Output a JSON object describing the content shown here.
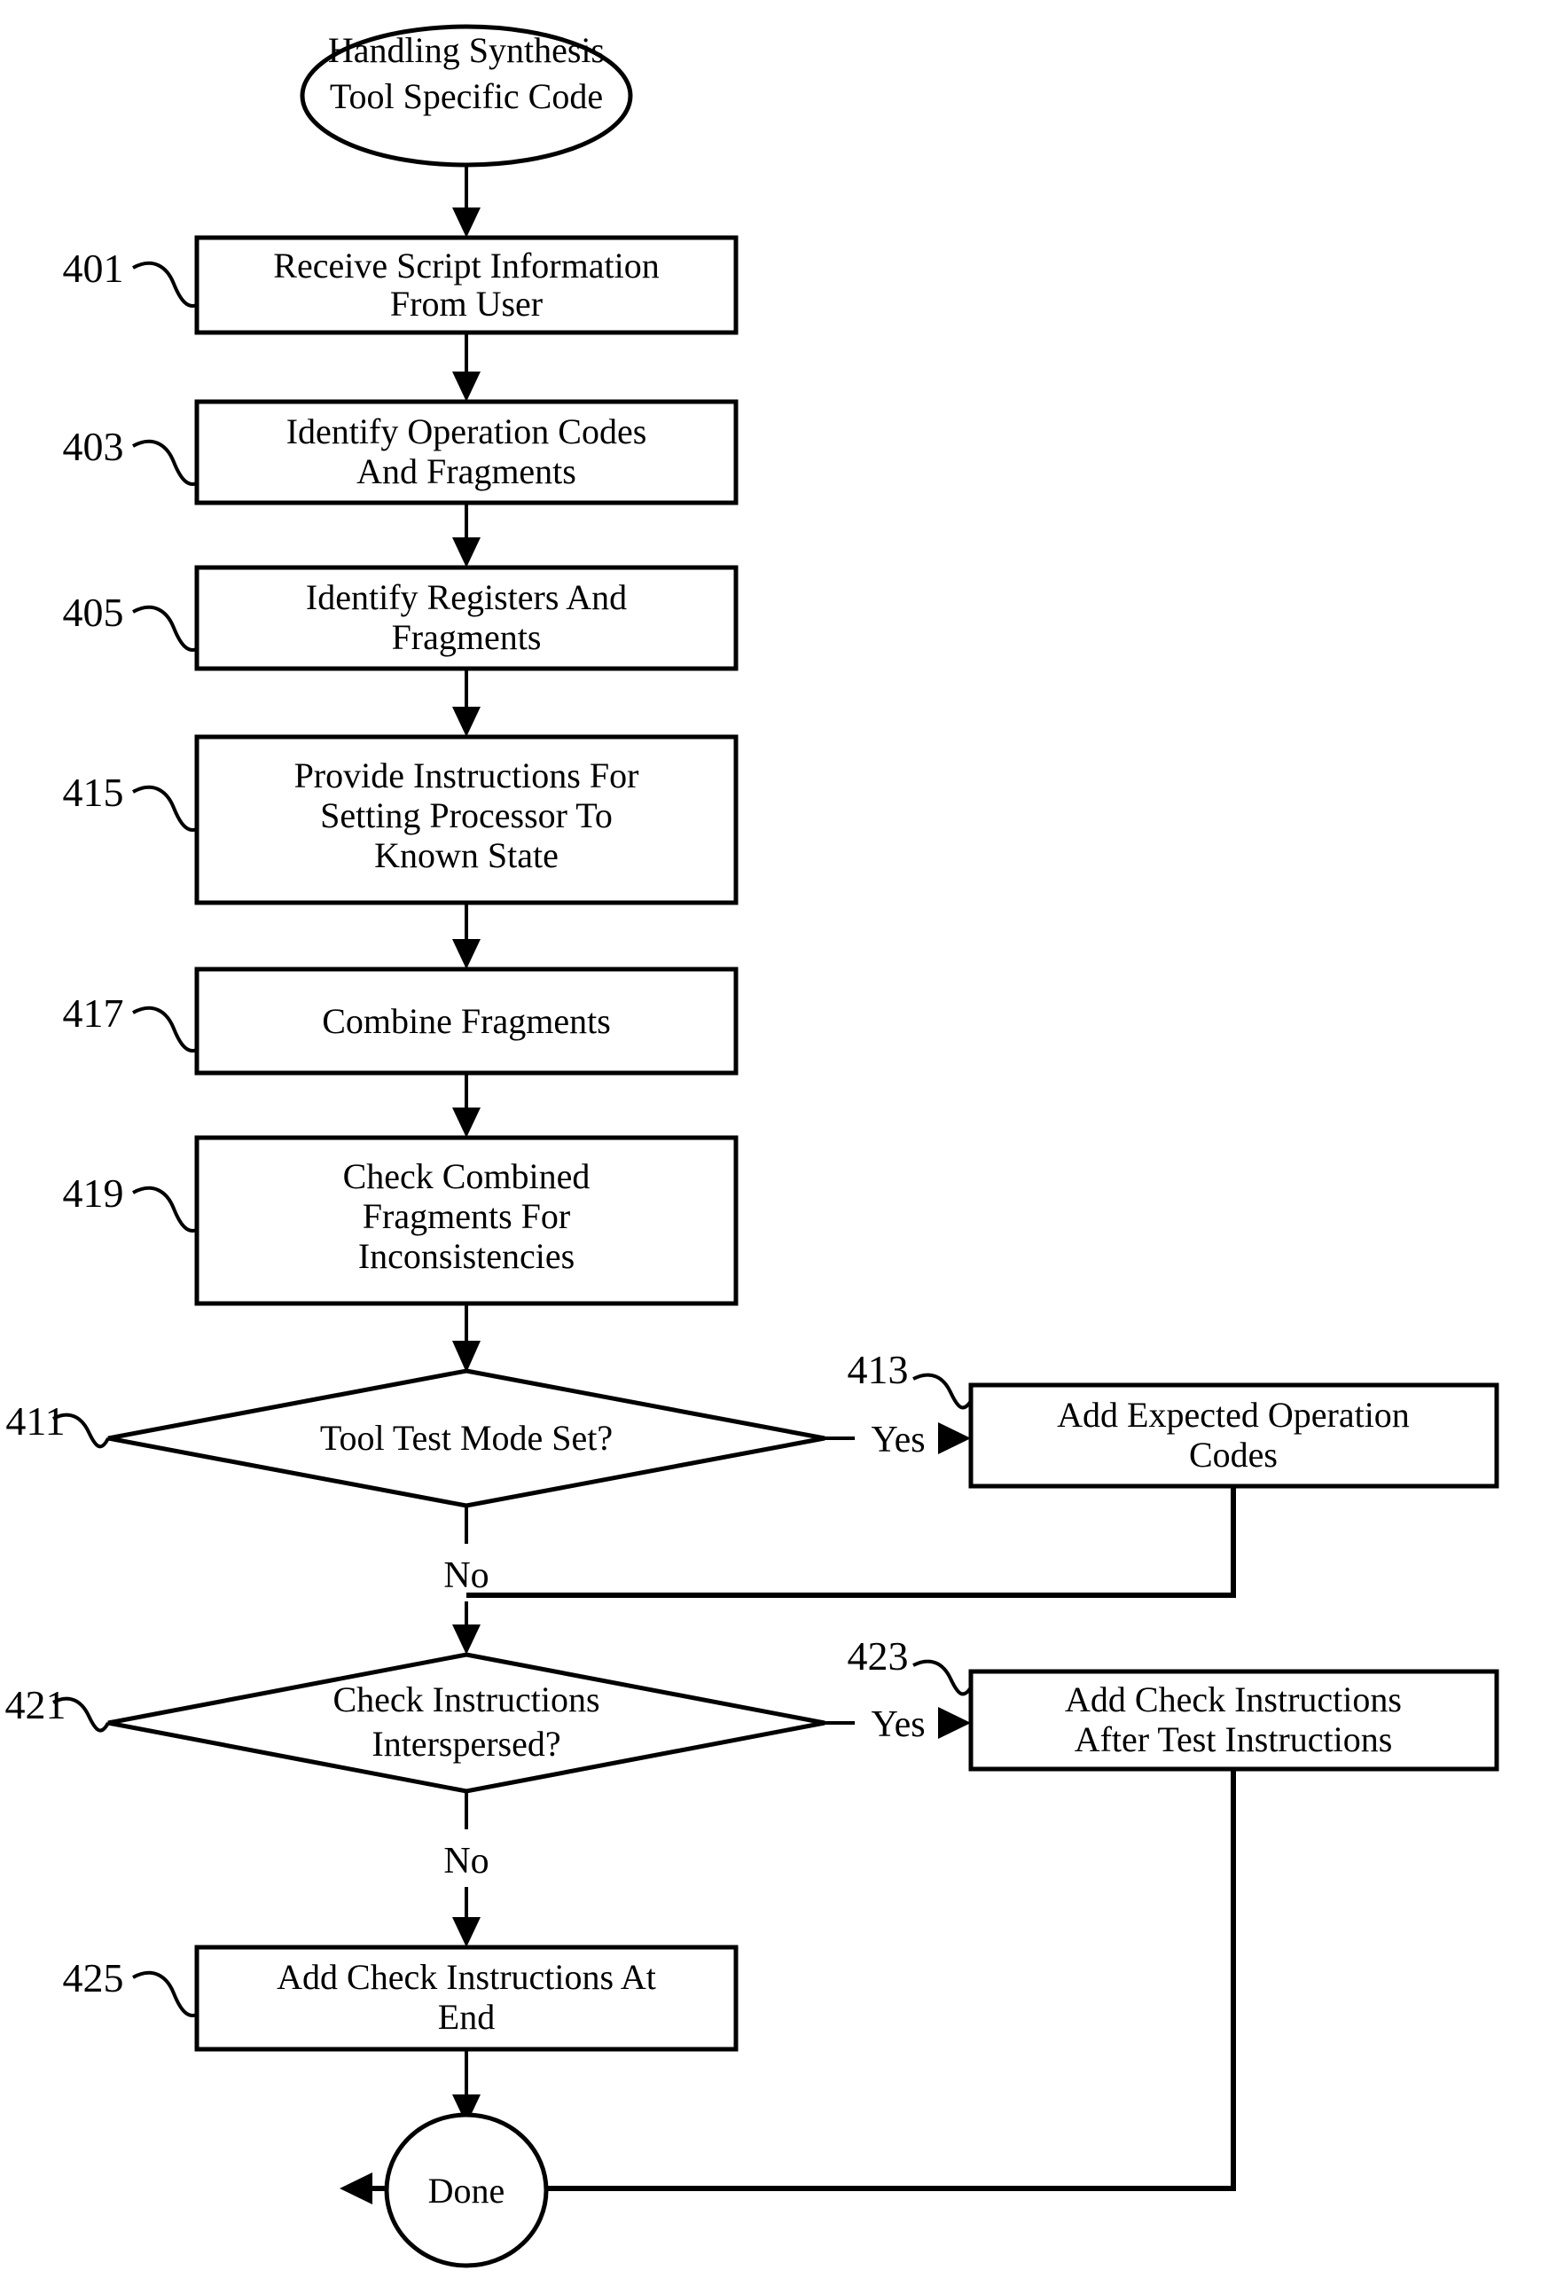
{
  "figure": {
    "title": "Handling Synthesis Tool Specific Code",
    "type": "flowchart"
  },
  "start": {
    "name": "start-terminal",
    "line1": "Handling Synthesis",
    "line2": "Tool Specific Code"
  },
  "steps": [
    {
      "ref": "401",
      "name": "receive-script-information",
      "lines": [
        "Receive Script Information",
        "From User"
      ]
    },
    {
      "ref": "403",
      "name": "identify-operation-codes",
      "lines": [
        "Identify Operation Codes",
        "And Fragments"
      ]
    },
    {
      "ref": "405",
      "name": "identify-registers",
      "lines": [
        "Identify Registers And",
        "Fragments"
      ]
    },
    {
      "ref": "415",
      "name": "provide-instructions-known-state",
      "lines": [
        "Provide Instructions For",
        "Setting Processor To",
        "Known State"
      ]
    },
    {
      "ref": "417",
      "name": "combine-fragments",
      "lines": [
        "Combine Fragments"
      ]
    },
    {
      "ref": "419",
      "name": "check-combined-fragments",
      "lines": [
        "Check Combined",
        "Fragments For",
        "Inconsistencies"
      ]
    }
  ],
  "decisions": [
    {
      "ref": "411",
      "name": "tool-test-mode-decision",
      "lines": [
        "Tool Test Mode Set?"
      ],
      "yes_label": "Yes",
      "no_label": "No"
    },
    {
      "ref": "421",
      "name": "check-instructions-interspersed-decision",
      "lines": [
        "Check Instructions",
        "Interspersed?"
      ],
      "yes_label": "Yes",
      "no_label": "No"
    }
  ],
  "branch_steps": [
    {
      "ref": "413",
      "name": "add-expected-operation-codes",
      "lines": [
        "Add Expected Operation",
        "Codes"
      ]
    },
    {
      "ref": "423",
      "name": "add-check-instructions-after-test",
      "lines": [
        "Add Check Instructions",
        "After Test Instructions"
      ]
    }
  ],
  "final_step": {
    "ref": "425",
    "name": "add-check-instructions-at-end",
    "lines": [
      "Add Check Instructions At",
      "End"
    ]
  },
  "end": {
    "name": "end-terminal",
    "label": "Done"
  },
  "colors": {
    "stroke": "#000000",
    "fill": "#ffffff",
    "text": "#000000"
  }
}
